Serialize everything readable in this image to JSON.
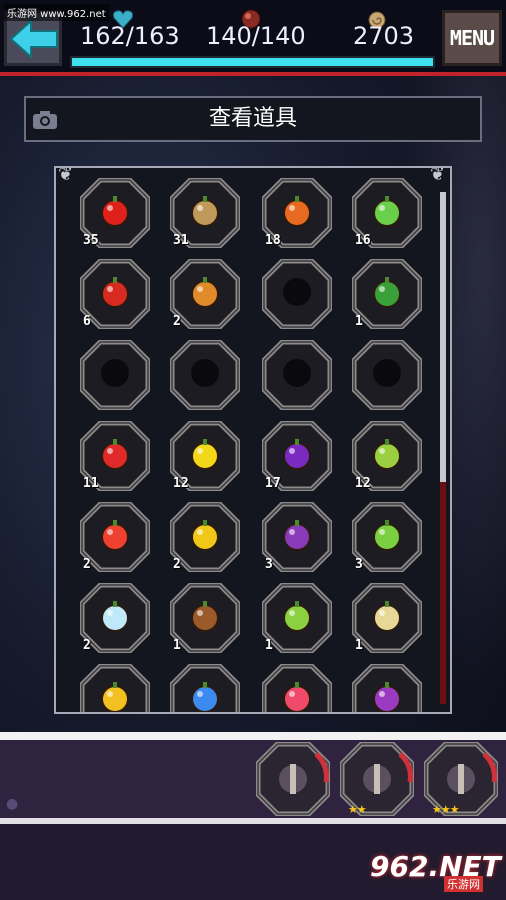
{
  "watermark": "乐游网 www.962.net",
  "stats": {
    "hp": "162/163",
    "mp": "140/140",
    "money": "2703"
  },
  "menu_label": "MENU",
  "title": "查看道具",
  "colors": {
    "hp_bar": "#3fe0ee",
    "accent_red": "#c0242a",
    "panel_border": "#a7a9b6"
  },
  "items": [
    {
      "icon": "tomato-icon",
      "count": "35",
      "color": "#e0201a",
      "known": true
    },
    {
      "icon": "potato-icon",
      "count": "31",
      "color": "#c09a5a",
      "known": true
    },
    {
      "icon": "carrot-icon",
      "count": "18",
      "color": "#e86a20",
      "known": true
    },
    {
      "icon": "cucumber-icon",
      "count": "16",
      "color": "#6ad04a",
      "known": true
    },
    {
      "icon": "red-tomato-icon",
      "count": "6",
      "color": "#d82a20",
      "known": true
    },
    {
      "icon": "onion-icon",
      "count": "2",
      "color": "#e08a2a",
      "known": true
    },
    {
      "icon": "unknown-icon",
      "count": "",
      "color": "#000",
      "known": false
    },
    {
      "icon": "broccoli-icon",
      "count": "1",
      "color": "#3aa03a",
      "known": true
    },
    {
      "icon": "unknown-icon",
      "count": "",
      "color": "#000",
      "known": false
    },
    {
      "icon": "unknown-icon",
      "count": "",
      "color": "#000",
      "known": false
    },
    {
      "icon": "unknown-icon",
      "count": "",
      "color": "#000",
      "known": false
    },
    {
      "icon": "unknown-icon",
      "count": "",
      "color": "#000",
      "known": false
    },
    {
      "icon": "strawberry-icon",
      "count": "11",
      "color": "#e02a2a",
      "known": true
    },
    {
      "icon": "lemon-icon",
      "count": "12",
      "color": "#f2d818",
      "known": true
    },
    {
      "icon": "cherry-icon",
      "count": "17",
      "color": "#7a2ac0",
      "known": true
    },
    {
      "icon": "pear-icon",
      "count": "12",
      "color": "#9ad040",
      "known": true
    },
    {
      "icon": "strawberry-icon",
      "count": "2",
      "color": "#f04030",
      "known": true
    },
    {
      "icon": "orange-icon",
      "count": "2",
      "color": "#f2c818",
      "known": true
    },
    {
      "icon": "grape-icon",
      "count": "3",
      "color": "#8a3ab8",
      "known": true
    },
    {
      "icon": "green-apple-icon",
      "count": "3",
      "color": "#7ad040",
      "known": true
    },
    {
      "icon": "ice-apple-icon",
      "count": "2",
      "color": "#bfe8f8",
      "known": true
    },
    {
      "icon": "brown-apple-icon",
      "count": "1",
      "color": "#9a5a2a",
      "known": true
    },
    {
      "icon": "lime-apple-icon",
      "count": "1",
      "color": "#8ad040",
      "known": true
    },
    {
      "icon": "cream-apple-icon",
      "count": "1",
      "color": "#e8d898",
      "known": true
    },
    {
      "icon": "gold-apple-icon",
      "count": "",
      "color": "#f2c020",
      "known": true
    },
    {
      "icon": "blue-apple-icon",
      "count": "",
      "color": "#3a8af0",
      "known": true
    },
    {
      "icon": "pink-apple-icon",
      "count": "",
      "color": "#f04a6a",
      "known": true
    },
    {
      "icon": "purple-apple-icon",
      "count": "",
      "color": "#9a3ac0",
      "known": true
    }
  ],
  "equipment": [
    {
      "icon": "helmet-icon",
      "stars": ""
    },
    {
      "icon": "claw-icon",
      "stars": "★★"
    },
    {
      "icon": "sword-icon",
      "stars": "★★★"
    }
  ],
  "logo": {
    "num": "962.NET",
    "sub": "乐游网"
  }
}
